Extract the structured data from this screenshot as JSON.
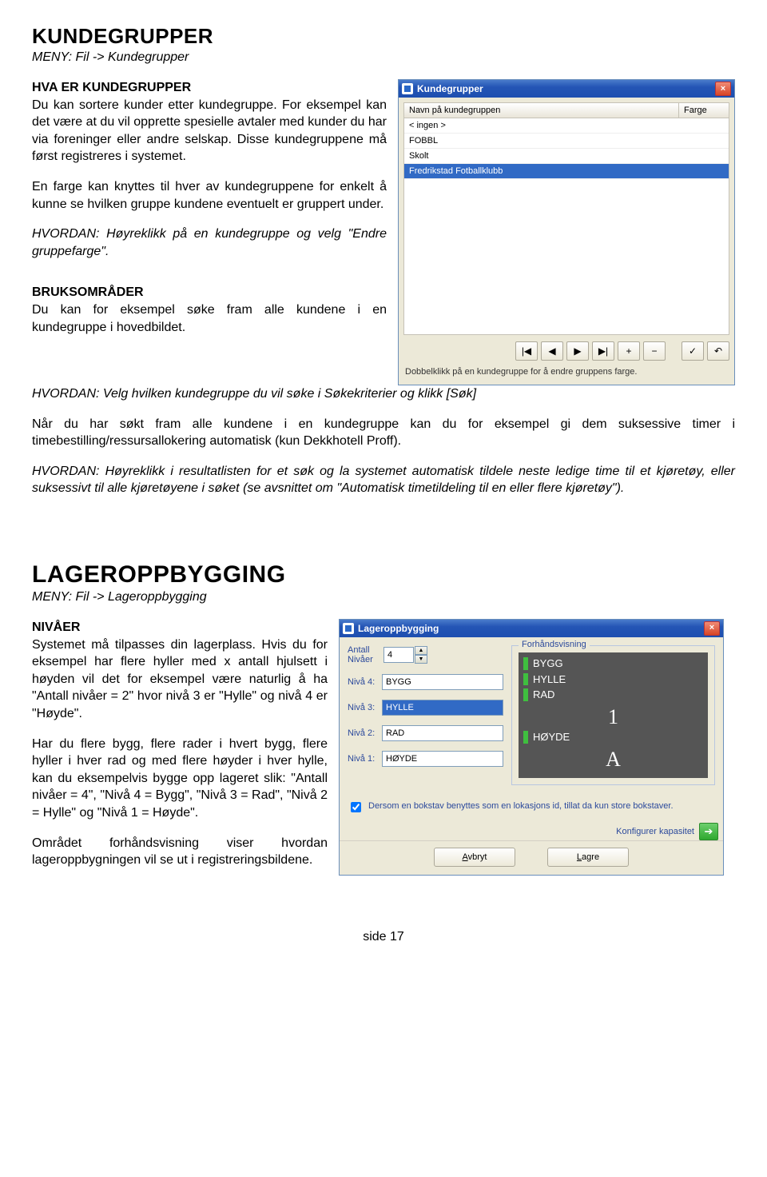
{
  "h1_kund": "KUNDEGRUPPER",
  "meny_kund": "MENY: Fil -> Kundegrupper",
  "sub_hva": "HVA ER KUNDEGRUPPER",
  "p_hva": "Du kan sortere kunder etter kundegruppe. For eksempel kan det være at du vil opprette spesielle avtaler med kunder du har via foreninger eller andre selskap. Disse kundegruppene må først registreres i systemet.",
  "p_farge": "En farge kan knyttes til hver av kundegruppene for enkelt å kunne se hvilken gruppe kundene eventuelt er gruppert under.",
  "p_hvordan1": "HVORDAN: Høyreklikk på en kundegruppe og velg \"Endre gruppefarge\".",
  "sub_bruk": "BRUKSOMRÅDER",
  "p_bruk": "Du kan for eksempel søke fram alle kundene i en kundegruppe i hovedbildet.",
  "p_hvordan2": "HVORDAN: Velg hvilken kundegruppe du vil søke i Søkekriterier og klikk [Søk]",
  "p_sok": "Når du har søkt fram alle kundene i en kundegruppe kan du for eksempel gi dem suksessive timer i timebestilling/ressursallokering automatisk (kun Dekkhotell Proff).",
  "p_hvordan3": "HVORDAN: Høyreklikk i resultatlisten for et søk og la systemet automatisk tildele neste ledige time til et kjøretøy, eller suksessivt til alle kjøretøyene i søket (se avsnittet om \"Automatisk timetildeling til en eller flere kjøretøy\").",
  "h1_lager": "LAGEROPPBYGGING",
  "meny_lager": "MENY: Fil -> Lageroppbygging",
  "sub_niv": "NIVÅER",
  "p_niv1": "Systemet må tilpasses din lagerplass. Hvis du for eksempel har flere hyller med x antall hjulsett i høyden vil det for eksempel være naturlig å ha \"Antall nivåer = 2\" hvor nivå 3 er \"Hylle\" og nivå 4 er \"Høyde\".",
  "p_niv2": "Har du flere bygg, flere rader i hvert bygg, flere hyller i hver rad og med flere høyder i hver hylle, kan du eksempelvis bygge opp lageret slik: \"Antall nivåer = 4\", \"Nivå 4 = Bygg\", \"Nivå 3 = Rad\", \"Nivå 2 = Hylle\" og \"Nivå 1 = Høyde\".",
  "p_niv3": "Området forhåndsvisning viser hvordan lageroppbygningen vil se ut i registreringsbildene.",
  "winK": {
    "title": "Kundegrupper",
    "col1": "Navn på kundegruppen",
    "col2": "Farge",
    "rows": [
      "< ingen >",
      "FOBBL",
      "Skolt",
      "Fredrikstad Fotballklubb"
    ],
    "hint": "Dobbelklikk på en kundegruppe for å endre gruppens farge.",
    "tb": {
      "first": "|◀",
      "prev": "◀",
      "next": "▶",
      "last": "▶|",
      "add": "+",
      "del": "−",
      "ok": "✓",
      "undo": "↶"
    }
  },
  "winL": {
    "title": "Lageroppbygging",
    "antall_lab": "Antall Nivåer",
    "antall_val": "4",
    "rows": [
      {
        "lab": "Nivå 4:",
        "val": "BYGG"
      },
      {
        "lab": "Nivå 3:",
        "val": "HYLLE",
        "sel": true
      },
      {
        "lab": "Nivå 2:",
        "val": "RAD"
      },
      {
        "lab": "Nivå 1:",
        "val": "HØYDE"
      }
    ],
    "legend": "Forhåndsvisning",
    "preview": [
      "BYGG",
      "HYLLE",
      "RAD",
      "HØYDE"
    ],
    "big1": "1",
    "big2": "A",
    "chk": "Dersom en bokstav benyttes som en lokasjons id, tillat da kun store bokstaver.",
    "konf": "Konfigurer kapasitet",
    "avbryt": "Avbryt",
    "lagre": "Lagre"
  },
  "footer": "side  17"
}
